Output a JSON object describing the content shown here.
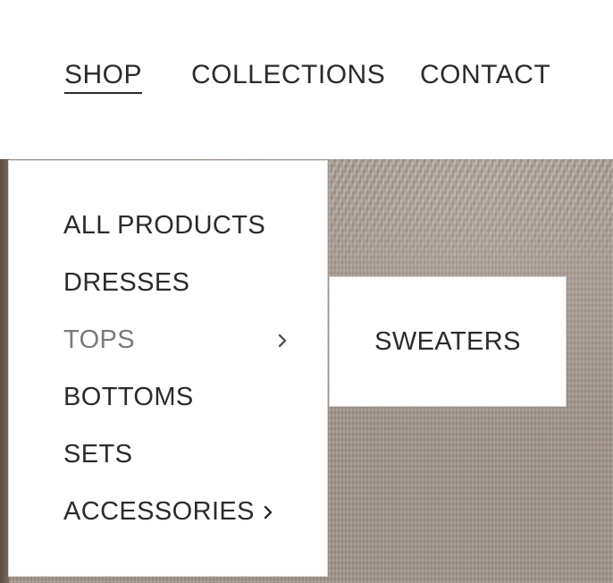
{
  "nav": {
    "items": [
      {
        "label": "SHOP",
        "active": true
      },
      {
        "label": "COLLECTIONS",
        "active": false
      },
      {
        "label": "CONTACT",
        "active": false
      }
    ]
  },
  "dropdown": {
    "items": [
      {
        "label": "ALL PRODUCTS",
        "has_submenu": false,
        "active": false
      },
      {
        "label": "DRESSES",
        "has_submenu": false,
        "active": false
      },
      {
        "label": "TOPS",
        "has_submenu": true,
        "active": true
      },
      {
        "label": "BOTTOMS",
        "has_submenu": false,
        "active": false
      },
      {
        "label": "SETS",
        "has_submenu": false,
        "active": false
      },
      {
        "label": "ACCESSORIES",
        "has_submenu": true,
        "active": false
      }
    ]
  },
  "submenu": {
    "items": [
      {
        "label": "SWEATERS"
      }
    ]
  },
  "colors": {
    "text": "#2b2b2b",
    "active_menu_text": "#7a7a7a",
    "background_image_tone": "#a1958b"
  },
  "icons": {
    "submenu_indicator": "chevron-right-icon"
  }
}
